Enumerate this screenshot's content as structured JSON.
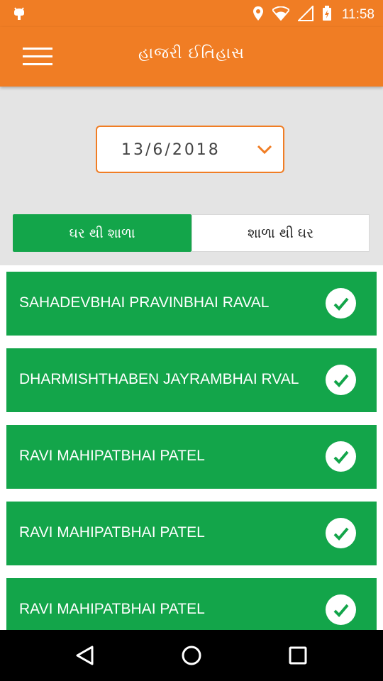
{
  "status_bar": {
    "time": "11:58",
    "icons": [
      "android-debug-icon",
      "location-icon",
      "wifi-icon",
      "signal-icon",
      "battery-icon"
    ]
  },
  "app_bar": {
    "title": "હાજરી ઈતિહાસ",
    "menu_icon": "hamburger-menu-icon"
  },
  "filter": {
    "date": "13/6/2018",
    "dropdown_icon": "chevron-down-icon",
    "tabs": [
      {
        "label": "ઘર થી શાળા",
        "active": true
      },
      {
        "label": "શાળા થી ઘર",
        "active": false
      }
    ]
  },
  "attendance": {
    "items": [
      {
        "name": "SAHADEVBHAI PRAVINBHAI RAVAL",
        "present": true
      },
      {
        "name": "DHARMISHTHABEN JAYRAMBHAI RVAL",
        "present": true
      },
      {
        "name": "RAVI MAHIPATBHAI PATEL",
        "present": true
      },
      {
        "name": "RAVI MAHIPATBHAI PATEL",
        "present": true
      },
      {
        "name": "RAVI MAHIPATBHAI PATEL",
        "present": true
      }
    ]
  },
  "nav_bar": {
    "buttons": [
      "back-icon",
      "home-icon",
      "recents-icon"
    ]
  },
  "colors": {
    "accent_orange": "#f07d24",
    "present_green": "#13a54a",
    "background_gray": "#e4e4e4"
  }
}
